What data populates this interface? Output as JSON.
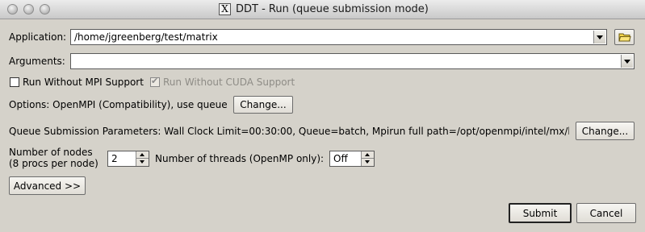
{
  "window": {
    "title": "DDT - Run (queue submission mode)"
  },
  "application": {
    "label": "Application:",
    "value": "/home/jgreenberg/test/matrix"
  },
  "arguments": {
    "label": "Arguments:",
    "value": ""
  },
  "checkboxes": {
    "no_mpi": {
      "label": "Run Without MPI Support",
      "checked": false
    },
    "no_cuda": {
      "label": "Run Without CUDA Support",
      "checked": true,
      "disabled": true
    }
  },
  "options": {
    "text": "Options: OpenMPI (Compatibility), use queue",
    "change_label": "Change..."
  },
  "queue": {
    "text": "Queue Submission Parameters: Wall Clock Limit=00:30:00, Queue=batch, Mpirun full path=/opt/openmpi/intel/mx/b",
    "change_label": "Change..."
  },
  "nodes": {
    "label_line1": "Number of nodes",
    "label_line2": "(8 procs per node)",
    "value": "2"
  },
  "threads": {
    "label": "Number of threads (OpenMP only):",
    "value": "Off"
  },
  "advanced_label": "Advanced >>",
  "submit_label": "Submit",
  "cancel_label": "Cancel",
  "icons": {
    "folder": "folder-open-icon",
    "window": "x11-icon"
  }
}
